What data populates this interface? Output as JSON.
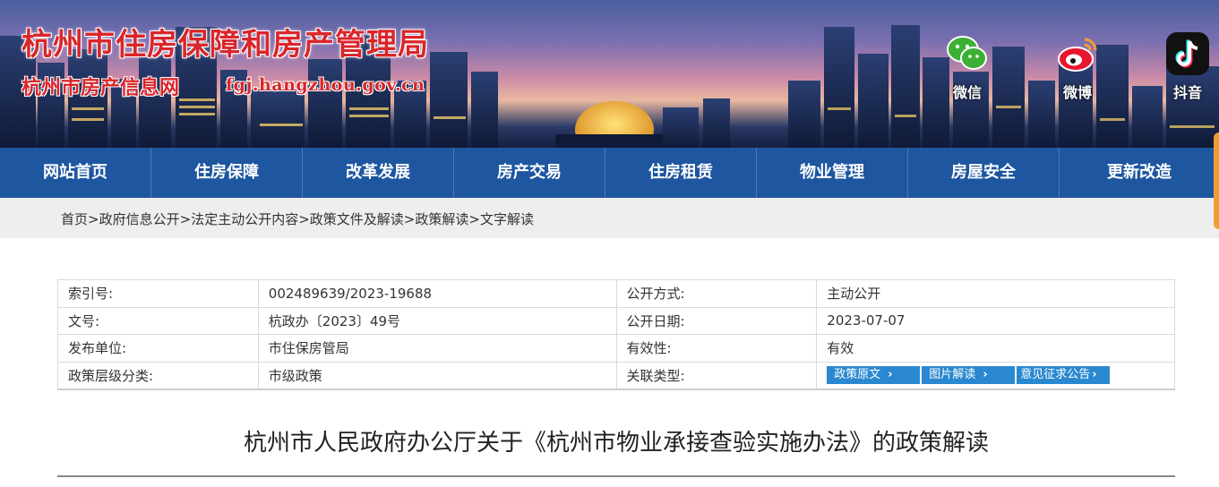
{
  "header": {
    "site_title": "杭州市住房保障和房产管理局",
    "site_subtitle": "杭州市房产信息网",
    "site_domain": "fgj.hangzhou.gov.cn",
    "social": [
      {
        "name": "wechat",
        "label": "微信",
        "icon": "wechat-icon",
        "color": "#3cb034"
      },
      {
        "name": "weibo",
        "label": "微博",
        "icon": "weibo-icon",
        "color": "#e6162d"
      },
      {
        "name": "douyin",
        "label": "抖音",
        "icon": "douyin-icon",
        "color": "#111111"
      }
    ]
  },
  "nav": {
    "items": [
      "网站首页",
      "住房保障",
      "改革发展",
      "房产交易",
      "住房租赁",
      "物业管理",
      "房屋安全",
      "更新改造"
    ],
    "color": "#1e56a0"
  },
  "breadcrumb": {
    "items": [
      "首页",
      "政府信息公开",
      "法定主动公开内容",
      "政策文件及解读",
      "政策解读",
      "文字解读"
    ],
    "separator": ">"
  },
  "meta": {
    "rows": [
      {
        "k1": "索引号:",
        "v1": "002489639/2023-19688",
        "k2": "公开方式:",
        "v2": "主动公开"
      },
      {
        "k1": "文号:",
        "v1": "杭政办〔2023〕49号",
        "k2": "公开日期:",
        "v2": "2023-07-07"
      },
      {
        "k1": "发布单位:",
        "v1": "市住保房管局",
        "k2": "有效性:",
        "v2": "有效"
      },
      {
        "k1": "政策层级分类:",
        "v1": "市级政策",
        "k2": "关联类型:",
        "v2": ""
      }
    ],
    "related_buttons": [
      "政策原文",
      "图片解读",
      "意见征求公告"
    ],
    "button_color": "#2a88d0"
  },
  "article": {
    "title": "杭州市人民政府办公厅关于《杭州市物业承接查验实施办法》的政策解读"
  }
}
